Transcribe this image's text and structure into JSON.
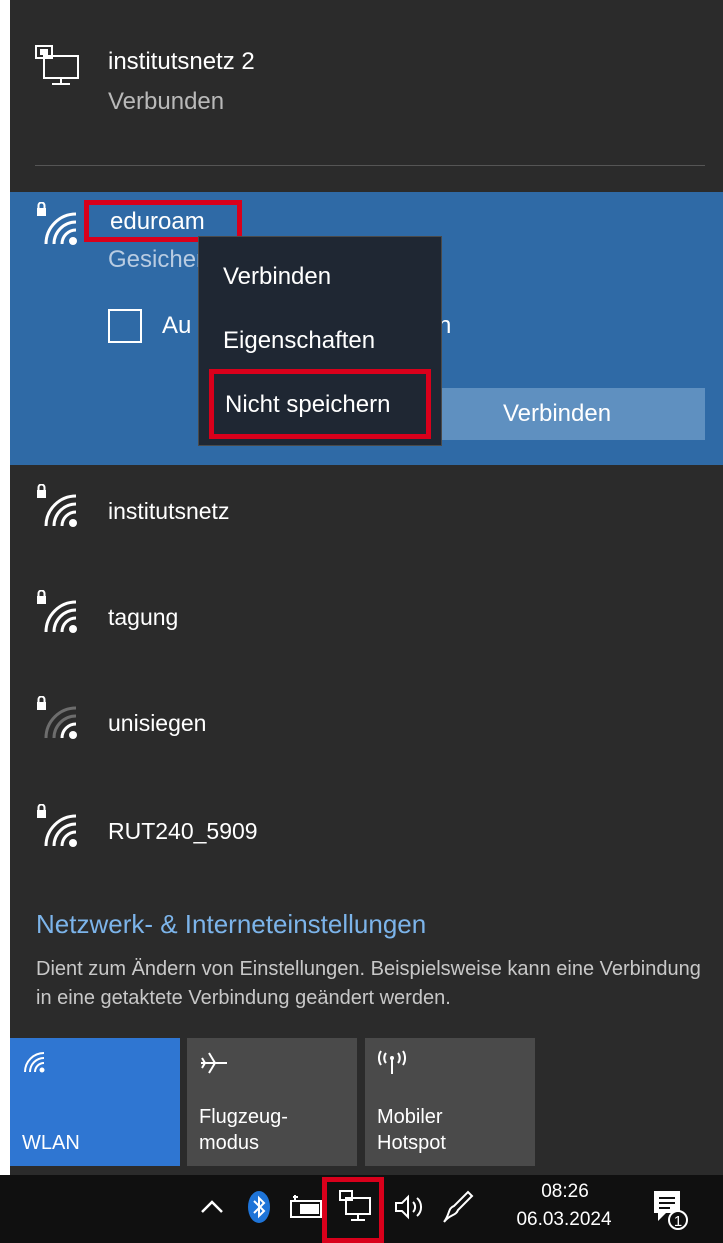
{
  "connected": {
    "name": "institutsnetz 2",
    "status": "Verbunden"
  },
  "expanded": {
    "name": "eduroam",
    "status": "Gesicher",
    "auto_label": "Au",
    "auto_tail": "n",
    "connect_label": "Verbinden"
  },
  "context_menu": {
    "items": [
      "Verbinden",
      "Eigenschaften",
      "Nicht speichern"
    ]
  },
  "networks": [
    {
      "name": "institutsnetz",
      "icon": "wifi-secured-icon"
    },
    {
      "name": "tagung",
      "icon": "wifi-secured-icon"
    },
    {
      "name": "unisiegen",
      "icon": "wifi-secured-weak-icon"
    },
    {
      "name": "RUT240_5909",
      "icon": "wifi-secured-icon"
    }
  ],
  "settings": {
    "link": "Netzwerk- & Interneteinstellungen",
    "description": "Dient zum Ändern von Einstellungen. Beispielsweise kann eine Verbindung in eine getaktete Verbindung geändert werden."
  },
  "tiles": [
    {
      "label": "WLAN",
      "icon": "wifi-icon",
      "active": true
    },
    {
      "label": "Flugzeug-\nmodus",
      "icon": "airplane-icon",
      "active": false
    },
    {
      "label": "Mobiler\nHotspot",
      "icon": "hotspot-icon",
      "active": false
    }
  ],
  "taskbar": {
    "time": "08:26",
    "date": "06.03.2024",
    "notification_count": "1"
  },
  "colors": {
    "panel": "#2b2b2b",
    "selected": "#2f6aa6",
    "accent": "#2f76d2",
    "highlight": "#d9001b"
  }
}
